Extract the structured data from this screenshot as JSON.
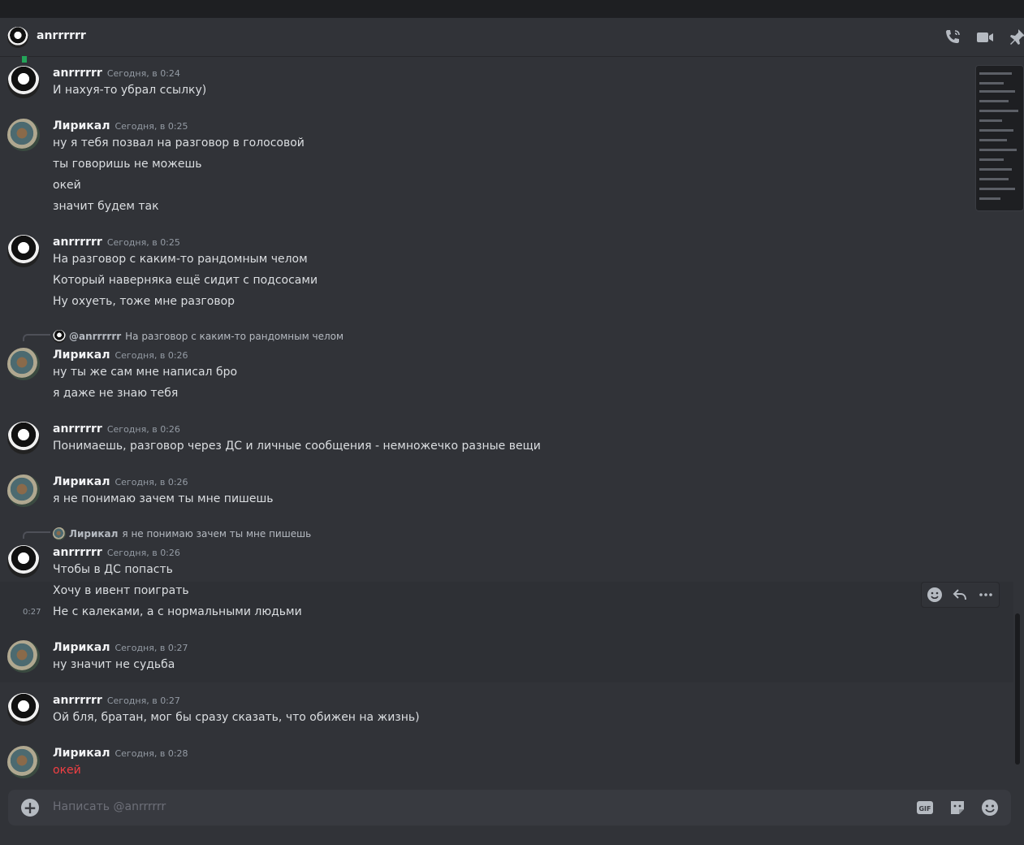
{
  "header": {
    "name": "anrrrrrr"
  },
  "messages": [
    {
      "author": "anrrrrrr",
      "timestamp": "Сегодня, в 0:24",
      "lines": [
        "И нахуя-то убрал ссылку)"
      ]
    },
    {
      "author": "Лирикал",
      "timestamp": "Сегодня, в 0:25",
      "lines": [
        "ну я тебя позвал на разговор в голосовой",
        "ты говоришь не можешь",
        "окей",
        "значит будем так"
      ]
    },
    {
      "author": "anrrrrrr",
      "timestamp": "Сегодня, в 0:25",
      "lines": [
        "На разговор с каким-то рандомным челом",
        "Который наверняка ещё сидит с подсосами",
        "Ну охуеть, тоже мне разговор"
      ]
    },
    {
      "reply_to": "@anrrrrrr",
      "reply_text": "На разговор с каким-то рандомным челом",
      "author": "Лирикал",
      "timestamp": "Сегодня, в 0:26",
      "lines": [
        "ну ты же сам мне написал бро",
        "я даже не знаю тебя"
      ]
    },
    {
      "author": "anrrrrrr",
      "timestamp": "Сегодня, в 0:26",
      "lines": [
        "Понимаешь, разговор через ДС и личные сообщения - немножечко разные вещи"
      ]
    },
    {
      "author": "Лирикал",
      "timestamp": "Сегодня, в 0:26",
      "lines": [
        "я не понимаю зачем ты мне пишешь"
      ]
    },
    {
      "reply_to": "Лирикал",
      "reply_text": "я не понимаю зачем ты мне пишешь",
      "author": "anrrrrrr",
      "timestamp": "Сегодня, в 0:26",
      "lines": [
        "Чтобы в ДС попасть",
        "Хочу в ивент поиграть",
        "Не с калеками, а с нормальными людьми"
      ],
      "side_time": "0:27"
    },
    {
      "author": "Лирикал",
      "timestamp": "Сегодня, в 0:27",
      "lines": [
        "ну значит не судьба"
      ]
    },
    {
      "author": "anrrrrrr",
      "timestamp": "Сегодня, в 0:27",
      "lines": [
        "Ой бля, братан, мог бы сразу сказать, что обижен на жизнь)"
      ]
    },
    {
      "author": "Лирикал",
      "timestamp": "Сегодня, в 0:28",
      "lines": [
        "окей"
      ],
      "line_color": "#f23f43"
    }
  ],
  "composer": {
    "placeholder": "Написать @anrrrrrr",
    "gif_label": "GIF"
  }
}
